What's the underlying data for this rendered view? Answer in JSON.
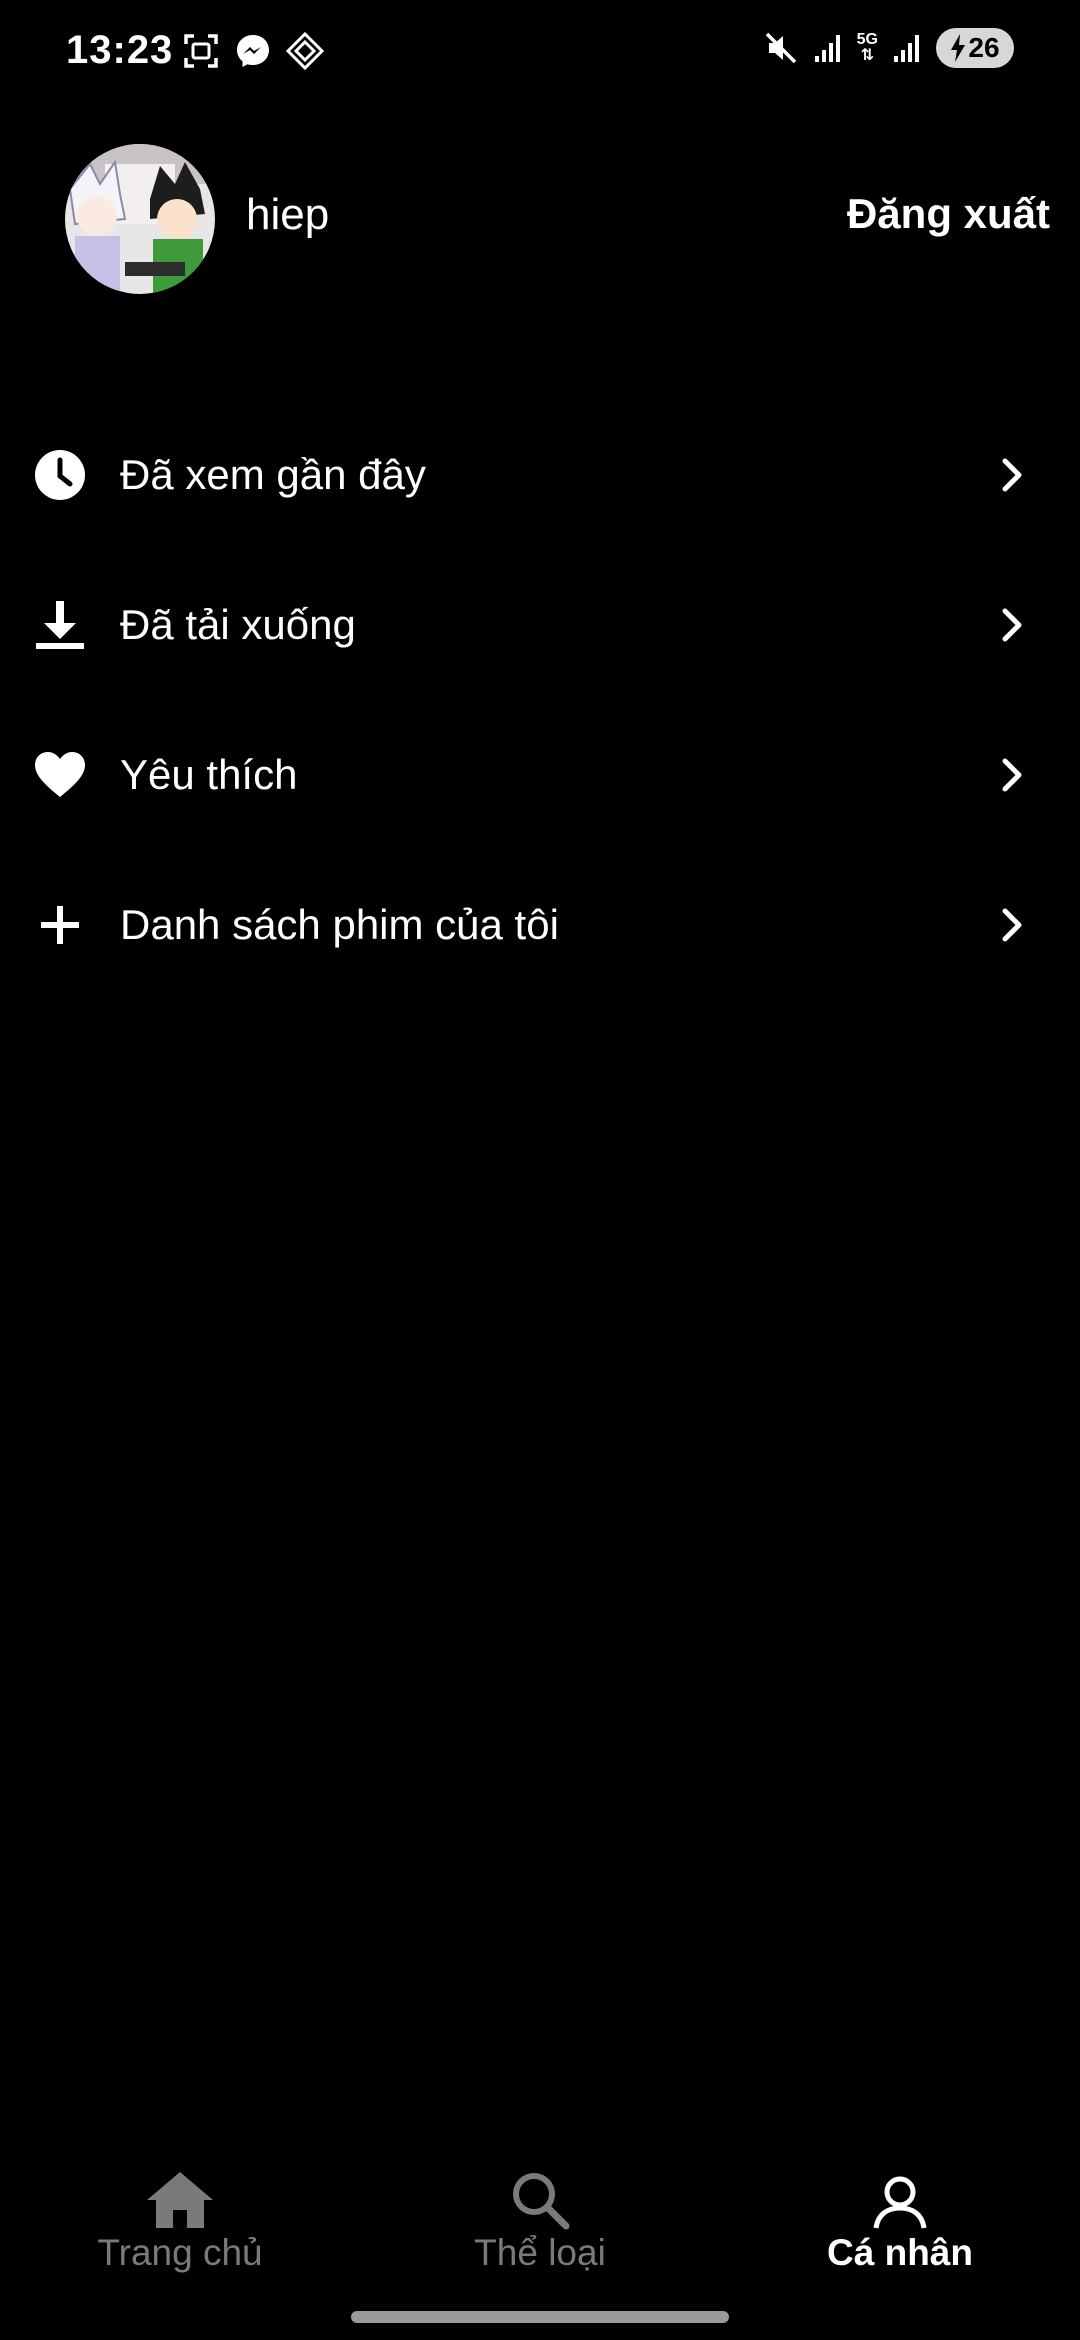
{
  "status_bar": {
    "time": "13:23",
    "network": "5G",
    "battery": "26",
    "left_icons": [
      "screenshot-icon",
      "messenger-icon",
      "diamond-app-icon"
    ],
    "right_icons": [
      "mute-icon",
      "signal-icon",
      "5g-icon",
      "signal-icon",
      "battery-icon"
    ]
  },
  "profile": {
    "username": "hiep",
    "logout_label": "Đăng xuất"
  },
  "menu": {
    "items": [
      {
        "label": "Đã xem gần đây",
        "icon": "clock-icon"
      },
      {
        "label": "Đã tải xuống",
        "icon": "download-icon"
      },
      {
        "label": "Yêu thích",
        "icon": "heart-icon"
      },
      {
        "label": "Danh sách phim của tôi",
        "icon": "plus-icon"
      }
    ]
  },
  "bottom_nav": {
    "items": [
      {
        "label": "Trang chủ",
        "icon": "home-icon",
        "active": false
      },
      {
        "label": "Thể loại",
        "icon": "search-icon",
        "active": false
      },
      {
        "label": "Cá nhân",
        "icon": "person-icon",
        "active": true
      }
    ]
  },
  "colors": {
    "background": "#000000",
    "text": "#ffffff",
    "inactive_nav": "#7a7a7a"
  }
}
